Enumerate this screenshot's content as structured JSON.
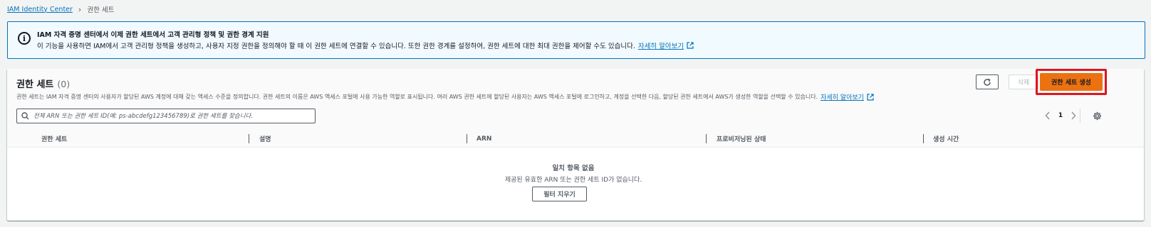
{
  "breadcrumb": {
    "root": "IAM Identity Center",
    "current": "권한 세트"
  },
  "banner": {
    "title": "IAM 자격 증명 센터에서 이제 권한 세트에서 고객 관리형 정책 및 권한 경계 지원",
    "body": "이 기능을 사용하면 IAM에서 고객 관리형 정책을 생성하고, 사용자 지정 권한을 정의해야 할 때 이 권한 세트에 연결할 수 있습니다. 또한 권한 경계를 설정하여, 권한 세트에 대한 최대 권한을 제어할 수도 있습니다.",
    "link": "자세히 알아보기",
    "icon": "info-icon"
  },
  "panel": {
    "title": "권한 세트",
    "count": "(0)",
    "description": "권한 세트는 IAM 자격 증명 센터의 사용자가 할당된 AWS 계정에 대해 갖는 액세스 수준을 정의합니다. 권한 세트의 이름은 AWS 액세스 포털에 사용 가능한 역할로 표시됩니다. 여러 AWS 권한 세트에 할당된 사용자는 AWS 액세스 포털에 로그인하고, 계정을 선택한 다음, 할당된 권한 세트에서 AWS가 생성한 역할을 선택할 수 있습니다.",
    "link": "자세히 알아보기"
  },
  "actions": {
    "delete": "삭제",
    "create": "권한 세트 생성"
  },
  "search": {
    "placeholder": "전체 ARN 또는 권한 세트 ID(예: ps-abcdefg123456789)로 권한 세트를 찾습니다."
  },
  "pagination": {
    "page": "1"
  },
  "table": {
    "columns": [
      "권한 세트",
      "설명",
      "ARN",
      "프로비저닝된 상태",
      "생성 시간"
    ],
    "rows": []
  },
  "empty": {
    "title": "일치 항목 없음",
    "description": "제공된 유효한 ARN 또는 권한 세트 ID가 없습니다.",
    "clear_button": "필터 지우기"
  },
  "colors": {
    "primary": "#ec7211",
    "link": "#0073bb",
    "highlight": "#e0141e"
  }
}
